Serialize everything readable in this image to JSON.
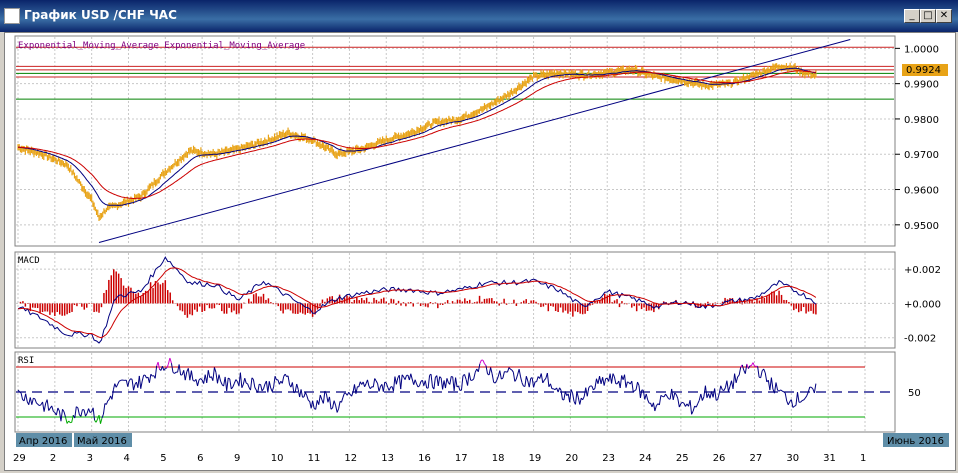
{
  "window": {
    "title": "График USD /CHF ЧАС"
  },
  "chart_data": [
    {
      "type": "line",
      "name": "price",
      "legend": "Exponential_Moving_Average Exponential_Moving_Average",
      "ylim": [
        0.944,
        1.0035
      ],
      "yticks": [
        1.0,
        0.99,
        0.98,
        0.97,
        0.96,
        0.95
      ],
      "ytick_labels": [
        "1.0000",
        "0.9900",
        "0.9800",
        "0.9700",
        "0.9600",
        "0.9500"
      ],
      "current_price": "0.9924",
      "hlines": [
        {
          "y": 1.0003,
          "color": "#cc2222"
        },
        {
          "y": 0.9949,
          "color": "#cc2222"
        },
        {
          "y": 0.9939,
          "color": "#cc2222"
        },
        {
          "y": 0.9929,
          "color": "#008000"
        },
        {
          "y": 0.9919,
          "color": "#cc2222"
        },
        {
          "y": 0.9856,
          "color": "#008000"
        }
      ],
      "trendline": {
        "from": [
          3.3,
          0.945
        ],
        "to": [
          33.9,
          1.0025
        ]
      },
      "colors": {
        "price": "#e8a317",
        "ema_fast": "#000080",
        "ema_slow": "#cc0000"
      },
      "anchors": [
        [
          0,
          0.972
        ],
        [
          1,
          0.97
        ],
        [
          2,
          0.967
        ],
        [
          3,
          0.957
        ],
        [
          3.3,
          0.952
        ],
        [
          3.6,
          0.9545
        ],
        [
          4,
          0.9555
        ],
        [
          5,
          0.958
        ],
        [
          6,
          0.965
        ],
        [
          7,
          0.971
        ],
        [
          8,
          0.97
        ],
        [
          9,
          0.9715
        ],
        [
          10,
          0.9735
        ],
        [
          11,
          0.976
        ],
        [
          12,
          0.974
        ],
        [
          13,
          0.97
        ],
        [
          14,
          0.9715
        ],
        [
          15,
          0.974
        ],
        [
          16,
          0.976
        ],
        [
          17,
          0.979
        ],
        [
          18,
          0.98
        ],
        [
          19,
          0.983
        ],
        [
          20,
          0.987
        ],
        [
          21,
          0.992
        ],
        [
          22,
          0.993
        ],
        [
          23,
          0.9925
        ],
        [
          24,
          0.993
        ],
        [
          25,
          0.994
        ],
        [
          26,
          0.992
        ],
        [
          27,
          0.991
        ],
        [
          28,
          0.9895
        ],
        [
          29,
          0.99
        ],
        [
          30,
          0.9925
        ],
        [
          31,
          0.995
        ],
        [
          31.6,
          0.9945
        ],
        [
          32,
          0.993
        ],
        [
          32.5,
          0.9924
        ]
      ]
    },
    {
      "type": "line",
      "name": "MACD",
      "title": "MACD",
      "ylim": [
        -0.0026,
        0.003
      ],
      "yticks": [
        0.002,
        0.0,
        -0.002
      ],
      "ytick_labels": [
        "+0.002",
        "+0.000",
        "-0.002"
      ],
      "colors": {
        "macd": "#000080",
        "signal": "#cc0000",
        "hist": "#cc0000"
      },
      "macd": [
        [
          0,
          -0.0002
        ],
        [
          1,
          -0.0009
        ],
        [
          2,
          -0.0018
        ],
        [
          3,
          -0.0018
        ],
        [
          3.3,
          -0.0024
        ],
        [
          4,
          0.0004
        ],
        [
          5,
          0.0007
        ],
        [
          6,
          0.0027
        ],
        [
          7,
          0.0012
        ],
        [
          8,
          0.0011
        ],
        [
          9,
          0.0002
        ],
        [
          10,
          0.0013
        ],
        [
          11,
          0.0004
        ],
        [
          12,
          -0.0005
        ],
        [
          13,
          0.0003
        ],
        [
          14,
          0.0006
        ],
        [
          15,
          0.0008
        ],
        [
          16,
          0.0008
        ],
        [
          17,
          0.0006
        ],
        [
          18,
          0.0008
        ],
        [
          19,
          0.0012
        ],
        [
          20,
          0.0012
        ],
        [
          21,
          0.0013
        ],
        [
          22,
          0.0008
        ],
        [
          23,
          -0.0002
        ],
        [
          24,
          0.0007
        ],
        [
          25,
          0.0003
        ],
        [
          26,
          -0.0002
        ],
        [
          27,
          0.0001
        ],
        [
          28,
          -0.0002
        ],
        [
          29,
          0.0001
        ],
        [
          30,
          0.0003
        ],
        [
          31,
          0.0012
        ],
        [
          32,
          0.0005
        ],
        [
          32.5,
          0.0001
        ]
      ]
    },
    {
      "type": "line",
      "name": "RSI",
      "title": "RSI",
      "ylim": [
        18,
        82
      ],
      "yticks": [
        50
      ],
      "ytick_labels": [
        "50"
      ],
      "levels": [
        70,
        30
      ],
      "colors": {
        "rsi": "#000080",
        "overbought": "#cc00cc",
        "oversold": "#00aa00"
      },
      "rsi": [
        [
          0,
          48
        ],
        [
          0.5,
          45
        ],
        [
          1,
          40
        ],
        [
          1.5,
          35
        ],
        [
          2,
          28
        ],
        [
          2.5,
          36
        ],
        [
          3,
          37
        ],
        [
          3.3,
          26
        ],
        [
          3.6,
          40
        ],
        [
          4,
          55
        ],
        [
          5,
          58
        ],
        [
          6,
          73
        ],
        [
          6.5,
          70
        ],
        [
          7,
          62
        ],
        [
          7.5,
          60
        ],
        [
          8,
          65
        ],
        [
          8.5,
          55
        ],
        [
          9,
          60
        ],
        [
          10,
          54
        ],
        [
          11,
          60
        ],
        [
          12,
          40
        ],
        [
          12.5,
          45
        ],
        [
          13,
          38
        ],
        [
          14,
          56
        ],
        [
          15,
          55
        ],
        [
          16,
          60
        ],
        [
          17,
          58
        ],
        [
          18,
          56
        ],
        [
          18.5,
          64
        ],
        [
          19,
          72
        ],
        [
          19.5,
          60
        ],
        [
          20,
          66
        ],
        [
          21,
          57
        ],
        [
          21.5,
          62
        ],
        [
          22,
          48
        ],
        [
          23,
          45
        ],
        [
          23.5,
          55
        ],
        [
          24,
          60
        ],
        [
          25,
          57
        ],
        [
          26,
          38
        ],
        [
          26.5,
          50
        ],
        [
          27,
          40
        ],
        [
          27.5,
          37
        ],
        [
          28,
          50
        ],
        [
          28.5,
          48
        ],
        [
          29,
          55
        ],
        [
          29.5,
          66
        ],
        [
          30,
          72
        ],
        [
          30.5,
          60
        ],
        [
          31,
          50
        ],
        [
          31.5,
          43
        ],
        [
          32,
          46
        ],
        [
          32.5,
          51
        ]
      ]
    }
  ],
  "x_axis": {
    "day_labels": [
      "29",
      "2",
      "3",
      "4",
      "5",
      "6",
      "9",
      "10",
      "11",
      "12",
      "13",
      "16",
      "17",
      "18",
      "19",
      "20",
      "23",
      "24",
      "25",
      "26",
      "27",
      "30",
      "31",
      "1"
    ],
    "day_index": [
      0,
      1.5,
      3,
      4.5,
      6,
      7.5,
      9,
      10.5,
      12,
      13.5,
      15,
      16.5,
      18,
      19.5,
      21,
      22.5,
      24,
      25.5,
      27,
      28.5,
      30,
      31.5,
      33,
      34.5
    ],
    "month_labels": [
      "Апр 2016",
      "Май 2016",
      "Июнь 2016"
    ]
  }
}
